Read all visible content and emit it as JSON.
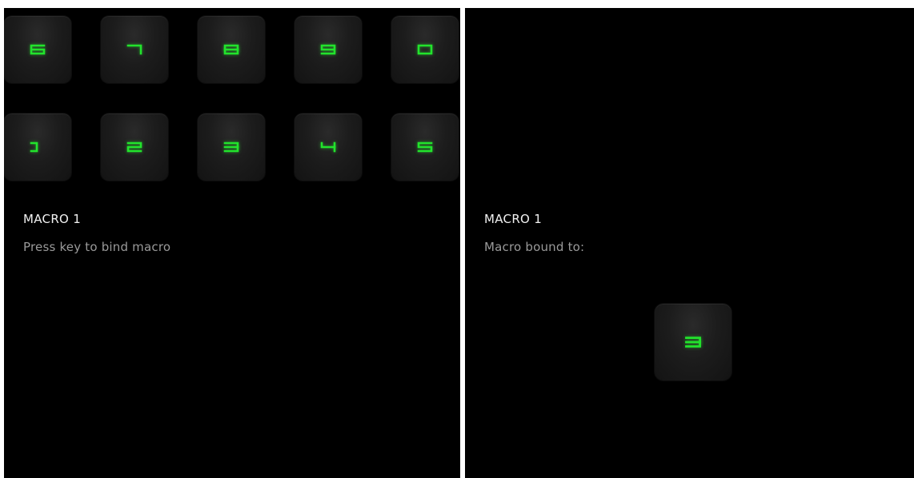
{
  "left_panel": {
    "key_rows": [
      [
        {
          "label": "6",
          "icon": "digit-6-icon"
        },
        {
          "label": "7",
          "icon": "digit-7-icon"
        },
        {
          "label": "8",
          "icon": "digit-8-icon"
        },
        {
          "label": "9",
          "icon": "digit-9-icon"
        },
        {
          "label": "0",
          "icon": "digit-0-icon"
        }
      ],
      [
        {
          "label": "1",
          "icon": "digit-1-icon"
        },
        {
          "label": "2",
          "icon": "digit-2-icon"
        },
        {
          "label": "3",
          "icon": "digit-3-icon"
        },
        {
          "label": "4",
          "icon": "digit-4-icon"
        },
        {
          "label": "5",
          "icon": "digit-5-icon"
        }
      ]
    ],
    "macro_title": "MACRO 1",
    "instruction": "Press key to bind macro"
  },
  "right_panel": {
    "macro_title": "MACRO 1",
    "status": "Macro bound to:",
    "bound_key": {
      "label": "3",
      "icon": "digit-3-icon"
    }
  },
  "colors": {
    "background": "#000000",
    "key_glow": "#22e32c",
    "title_text": "#f2f2f2",
    "subtitle_text": "#9a9a9a"
  }
}
